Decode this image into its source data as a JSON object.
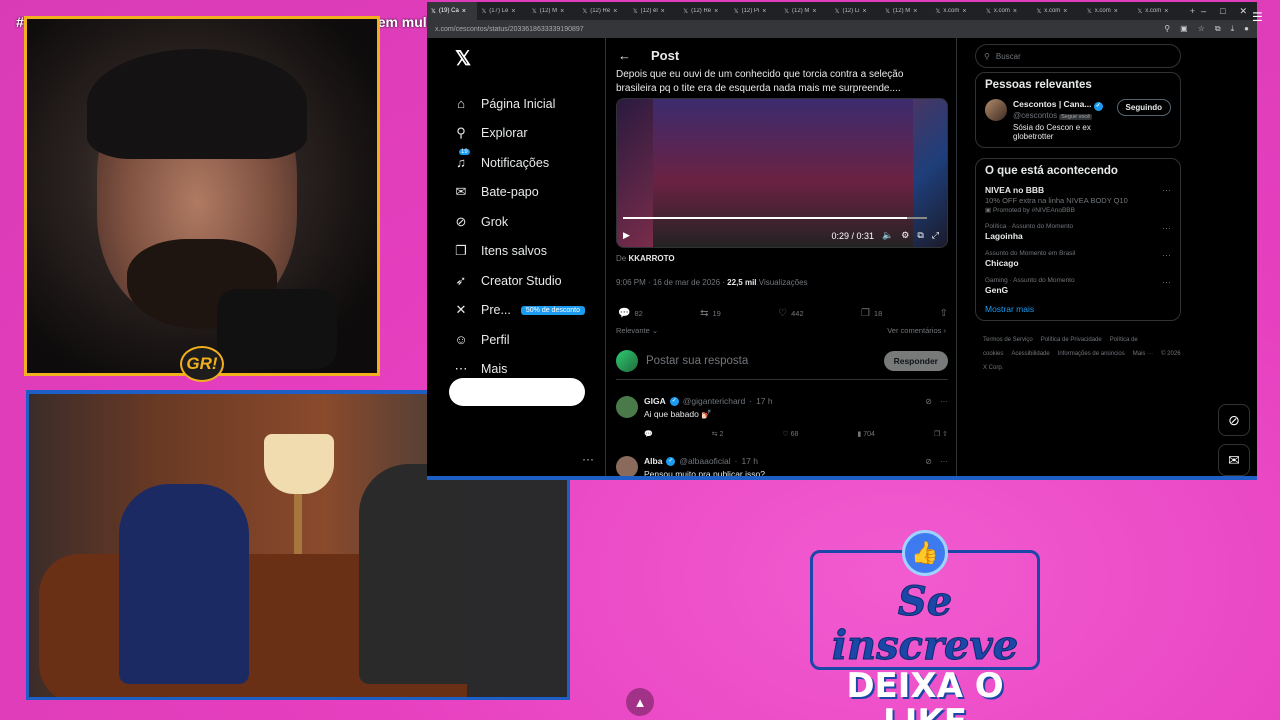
{
  "stream": {
    "title_prefix": "#",
    "title": "em mulheres?, café balada e mais",
    "logo": "GR!"
  },
  "overlay": {
    "subscribe_line1": "Se inscreve",
    "subscribe_line2": "DEIXA O LIKE",
    "like_icon": "thumbs-up-icon"
  },
  "browser": {
    "tabs": [
      {
        "label": "(19) Ca",
        "active": true
      },
      {
        "label": "(17) Le"
      },
      {
        "label": "(12) M"
      },
      {
        "label": "(12) Re"
      },
      {
        "label": "(12) él"
      },
      {
        "label": "(12) Re"
      },
      {
        "label": "(12) Pi"
      },
      {
        "label": "(12) M"
      },
      {
        "label": "(12) Li"
      },
      {
        "label": "(12) M"
      },
      {
        "label": "x.com"
      },
      {
        "label": "x.com"
      },
      {
        "label": "x.com"
      },
      {
        "label": "x.com"
      },
      {
        "label": "x.com"
      }
    ],
    "url": "x.com/cescontos/status/2033618633339190897"
  },
  "nav": {
    "items": [
      {
        "label": "Página Inicial",
        "icon": "home-icon",
        "glyph": "⌂"
      },
      {
        "label": "Explorar",
        "icon": "search-icon",
        "glyph": "⚲"
      },
      {
        "label": "Notificações",
        "icon": "bell-icon",
        "glyph": "♫",
        "badge": "19"
      },
      {
        "label": "Bate-papo",
        "icon": "mail-icon",
        "glyph": "✉"
      },
      {
        "label": "Grok",
        "icon": "grok-icon",
        "glyph": "⊘"
      },
      {
        "label": "Itens salvos",
        "icon": "bookmark-icon",
        "glyph": "❐"
      },
      {
        "label": "Creator Studio",
        "icon": "rocket-icon",
        "glyph": "➶"
      },
      {
        "label": "Pre...",
        "icon": "x-premium-icon",
        "glyph": "✕",
        "promo": "50% de desconto"
      },
      {
        "label": "Perfil",
        "icon": "profile-icon",
        "glyph": "☺"
      },
      {
        "label": "Mais",
        "icon": "more-icon",
        "glyph": "⋯"
      }
    ]
  },
  "post": {
    "header": "Post",
    "text": "Depois que eu ouvi de um conhecido que torcia contra a seleção brasileira pq o tite era de esquerda nada mais me surpreende....",
    "video_time": "0:29 / 0:31",
    "video_progress": 0.935,
    "from_prefix": "De",
    "from_name": "KKARROTO",
    "time": "9:06 PM · 16 de mar de 2026 · ",
    "views": "22,5 mil",
    "views_label": "Visualizações",
    "replies": "82",
    "reposts": "19",
    "likes": "442",
    "bookmarks": "18",
    "sort": "Relevante",
    "see_comments": "Ver comentários",
    "reply_placeholder": "Postar sua resposta",
    "reply_button": "Responder"
  },
  "replies": [
    {
      "name": "GIGA",
      "handle": "@giganterichard",
      "time": "17 h",
      "text": "Ai que babado 💅🏻",
      "stats": {
        "replies": "",
        "reposts": "2",
        "likes": "68",
        "views": "704"
      },
      "color": "#4a7a4a"
    },
    {
      "name": "Alba",
      "handle": "@albaaoficial",
      "time": "17 h",
      "text": "Pensou muito pra publicar isso?",
      "color": "#8a6a5a"
    }
  ],
  "right": {
    "search_placeholder": "Buscar",
    "relevant_title": "Pessoas relevantes",
    "person": {
      "name": "Cescontos | Cana...",
      "handle": "@cescontos",
      "follows_you": "Segue você",
      "bio": "Sósia do Cescon e ex globetrotter",
      "button": "Seguindo"
    },
    "trends_title": "O que está acontecendo",
    "trends": [
      {
        "cat": "",
        "name": "NIVEA no BBB",
        "sub": "10% OFF extra na linha NIVEA BODY Q10",
        "promo": "Promoted by #NIVEAnoBBB"
      },
      {
        "cat": "Política · Assunto do Momento",
        "name": "Lagoinha"
      },
      {
        "cat": "Assunto do Momento em Brasil",
        "name": "Chicago"
      },
      {
        "cat": "Gaming · Assunto do Momento",
        "name": "GenG"
      }
    ],
    "show_more": "Mostrar mais",
    "footer": [
      "Termos de Serviço",
      "Política de Privacidade",
      "Política de cookies",
      "Acessibilidade",
      "Informações de anúncios",
      "Mais ···",
      "© 2026 X Corp."
    ]
  }
}
